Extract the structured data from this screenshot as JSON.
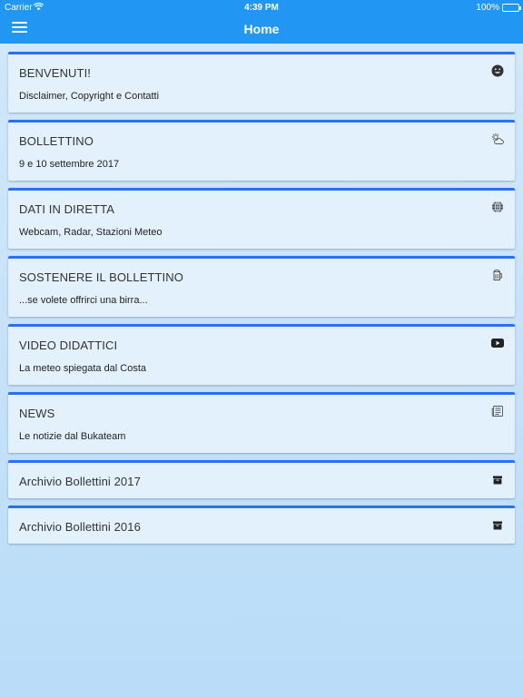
{
  "status_bar": {
    "carrier": "Carrier",
    "time": "4:39 PM",
    "battery": "100%"
  },
  "nav": {
    "title": "Home"
  },
  "cards": [
    {
      "title": "BENVENUTI!",
      "subtitle": "Disclaimer, Copyright e Contatti",
      "icon": "smiley-icon"
    },
    {
      "title": "BOLLETTINO",
      "subtitle": "9 e 10 settembre 2017",
      "icon": "partly-cloudy-icon"
    },
    {
      "title": "DATI IN DIRETTA",
      "subtitle": "Webcam, Radar, Stazioni Meteo",
      "icon": "globe-icon"
    },
    {
      "title": "SOSTENERE IL BOLLETTINO",
      "subtitle": "...se volete offrirci una birra...",
      "icon": "beer-mug-icon"
    },
    {
      "title": "VIDEO DIDATTICI",
      "subtitle": "La meteo spiegata dal Costa",
      "icon": "youtube-icon"
    },
    {
      "title": "NEWS",
      "subtitle": "Le notizie dal Bukateam",
      "icon": "newspaper-icon"
    },
    {
      "title": "Archivio Bollettini 2017",
      "icon": "archive-box-icon"
    },
    {
      "title": "Archivio Bollettini 2016",
      "icon": "archive-box-icon"
    }
  ],
  "colors": {
    "header": "#2196f3",
    "card_accent": "#2b6ff2",
    "card_background": "#e3f1fd",
    "page_background": "#c6e2f9"
  }
}
